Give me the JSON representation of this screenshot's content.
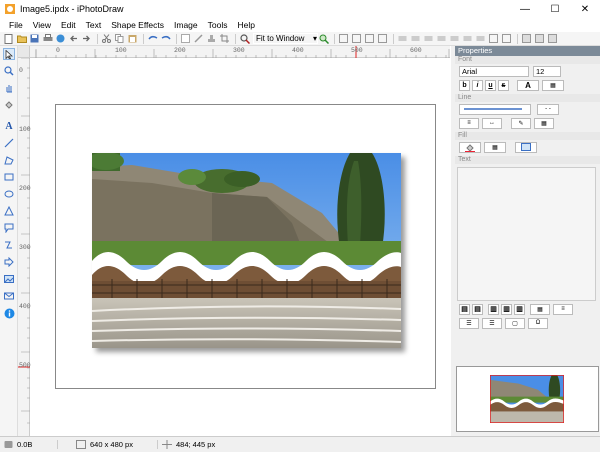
{
  "window": {
    "title": "Image5.ipdx - iPhotoDraw",
    "minimize": "—",
    "maximize": "☐",
    "close": "✕"
  },
  "menu": [
    "File",
    "View",
    "Edit",
    "Text",
    "Shape Effects",
    "Image",
    "Tools",
    "Help"
  ],
  "toolbar": {
    "zoom_value": "Fit to Window"
  },
  "ruler": {
    "h": [
      "0",
      "100",
      "200",
      "300",
      "400",
      "500",
      "600"
    ],
    "v": [
      "0",
      "100",
      "200",
      "300",
      "400",
      "500"
    ]
  },
  "properties": {
    "title": "Properties",
    "font_section": "Font",
    "font_family": "Arial",
    "font_size": "12",
    "bold": "b",
    "italic": "i",
    "underline": "u",
    "strike": "s",
    "text_color_icon": "A",
    "line_section": "Line",
    "fill_section": "Fill",
    "text_section": "Text"
  },
  "status": {
    "file_size": "0.0B",
    "image_size": "640 x 480 px",
    "cursor": "484; 445 px"
  }
}
